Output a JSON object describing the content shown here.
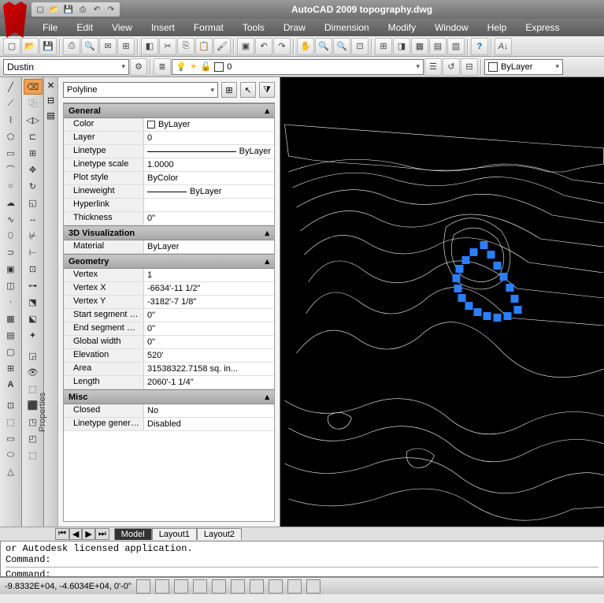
{
  "title": "AutoCAD 2009 topography.dwg",
  "menus": [
    "File",
    "Edit",
    "View",
    "Insert",
    "Format",
    "Tools",
    "Draw",
    "Dimension",
    "Modify",
    "Window",
    "Help",
    "Express"
  ],
  "style_combo": "Dustin",
  "layer_combo": "0",
  "bylayer": "ByLayer",
  "prop_combo": "Polyline",
  "sections": {
    "general": {
      "title": "General",
      "props": {
        "color_label": "Color",
        "color_val": "ByLayer",
        "layer_label": "Layer",
        "layer_val": "0",
        "linetype_label": "Linetype",
        "linetype_val": "ByLayer",
        "ltscale_label": "Linetype scale",
        "ltscale_val": "1.0000",
        "plotstyle_label": "Plot style",
        "plotstyle_val": "ByColor",
        "lineweight_label": "Lineweight",
        "lineweight_val": "ByLayer",
        "hyperlink_label": "Hyperlink",
        "hyperlink_val": "",
        "thickness_label": "Thickness",
        "thickness_val": "0\""
      }
    },
    "viz": {
      "title": "3D Visualization",
      "material_label": "Material",
      "material_val": "ByLayer"
    },
    "geom": {
      "title": "Geometry",
      "vertex_label": "Vertex",
      "vertex_val": "1",
      "vx_label": "Vertex X",
      "vx_val": "-6634'-11 1/2\"",
      "vy_label": "Vertex Y",
      "vy_val": "-3182'-7 1/8\"",
      "ssw_label": "Start segment w...",
      "ssw_val": "0\"",
      "esw_label": "End segment wi...",
      "esw_val": "0\"",
      "gw_label": "Global width",
      "gw_val": "0\"",
      "elev_label": "Elevation",
      "elev_val": "520'",
      "area_label": "Area",
      "area_val": "31538322.7158 sq. in...",
      "len_label": "Length",
      "len_val": "2060'-1 1/4\""
    },
    "misc": {
      "title": "Misc",
      "closed_label": "Closed",
      "closed_val": "No",
      "ltgen_label": "Linetype genera...",
      "ltgen_val": "Disabled"
    }
  },
  "prop_title": "Properties",
  "tabs": {
    "model": "Model",
    "l1": "Layout1",
    "l2": "Layout2"
  },
  "cmd": {
    "line1": "or Autodesk licensed application.",
    "line2": "Command:",
    "line3": "Command:"
  },
  "status_coords": "-9.8332E+04, -4.6034E+04, 0'-0\""
}
